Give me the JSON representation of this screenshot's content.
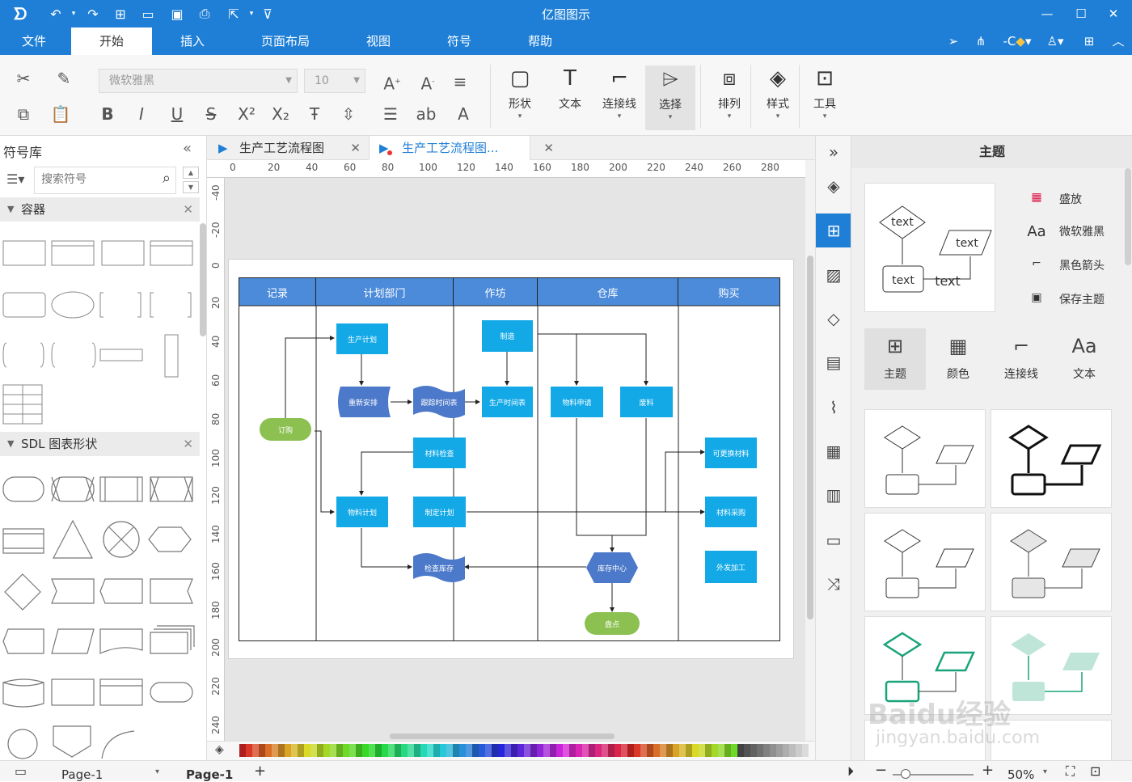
{
  "app": {
    "title": "亿图图示"
  },
  "menu": {
    "items": [
      "文件",
      "开始",
      "插入",
      "页面布局",
      "视图",
      "符号",
      "帮助"
    ],
    "active": "开始"
  },
  "ribbon": {
    "font_family": "微软雅黑",
    "font_size": "10",
    "big_buttons": [
      "形状",
      "文本",
      "连接线",
      "选择",
      "排列",
      "样式",
      "工具"
    ]
  },
  "symbol_library": {
    "title": "符号库",
    "search_placeholder": "搜索符号",
    "sections": [
      "容器",
      "SDL 图表形状"
    ]
  },
  "tabs": [
    "生产工艺流程图",
    "生产工艺流程图..."
  ],
  "ruler": {
    "h": [
      "0",
      "20",
      "40",
      "60",
      "80",
      "100",
      "120",
      "140",
      "160",
      "180",
      "200",
      "220",
      "240",
      "260",
      "280"
    ],
    "v": [
      "-40",
      "-20",
      "0",
      "20",
      "40",
      "60",
      "80",
      "100",
      "120",
      "140",
      "160",
      "180",
      "200",
      "220",
      "240"
    ]
  },
  "diagram": {
    "lanes": [
      "记录",
      "计划部门",
      "作坊",
      "仓库",
      "购买"
    ],
    "nodes": {
      "order": "订购",
      "production_plan": "生产计划",
      "reschedule": "重新安排",
      "track_schedule": "跟踪时间表",
      "make": "制造",
      "production_schedule": "生产时间表",
      "material_request": "物料申请",
      "scrap": "废料",
      "material_check": "材料检查",
      "material_plan": "物料计划",
      "make_plan": "制定计划",
      "replace_material": "可更换材料",
      "material_purchase": "材料采购",
      "check_stock": "检查库存",
      "stock_center": "库存中心",
      "outsource": "外发加工",
      "inventory": "盘点"
    }
  },
  "theme_panel": {
    "title": "主题",
    "options": [
      "盛放",
      "微软雅黑",
      "黑色箭头",
      "保存主题"
    ],
    "tabs": [
      "主题",
      "颜色",
      "连接线",
      "文本"
    ],
    "preview_text": "text"
  },
  "statusbar": {
    "page_selector": "Page-1",
    "page_tab": "Page-1",
    "zoom": "50%"
  },
  "colors": {
    "accent": "#1f7fd6",
    "node": "#13a9e7",
    "header": "#4c8bda",
    "terminal": "#8cc152",
    "hex": "#4c79c9"
  },
  "watermark": "Baidu经验 jingyan.baidu.com"
}
